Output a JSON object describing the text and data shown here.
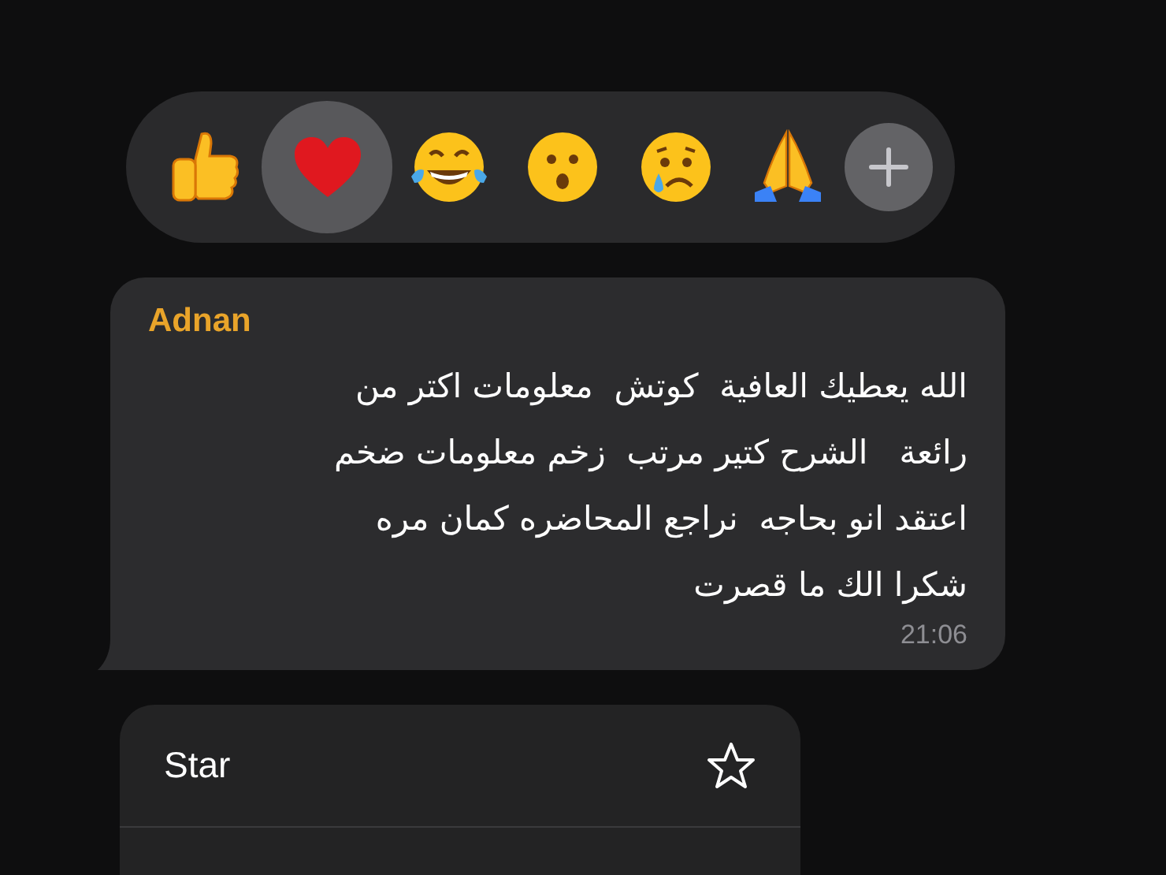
{
  "reactions": [
    {
      "kind": "thumbs-up",
      "selected": false
    },
    {
      "kind": "heart",
      "selected": true
    },
    {
      "kind": "tears-of-joy",
      "selected": false
    },
    {
      "kind": "surprised",
      "selected": false
    },
    {
      "kind": "crying",
      "selected": false
    },
    {
      "kind": "praying-hands",
      "selected": false
    },
    {
      "kind": "add",
      "selected": false
    }
  ],
  "message": {
    "sender": "Adnan",
    "text": "الله يعطيك العافية  كوتش  معلومات اكتر من\nرائعة   الشرح كتير مرتب  زخم معلومات ضخم\nاعتقد انو بحاجه  نراجع المحاضره كمان مره\nشكرا الك ما قصرت",
    "time": "21:06"
  },
  "menu": [
    {
      "label": "Star",
      "kind": "star"
    }
  ]
}
